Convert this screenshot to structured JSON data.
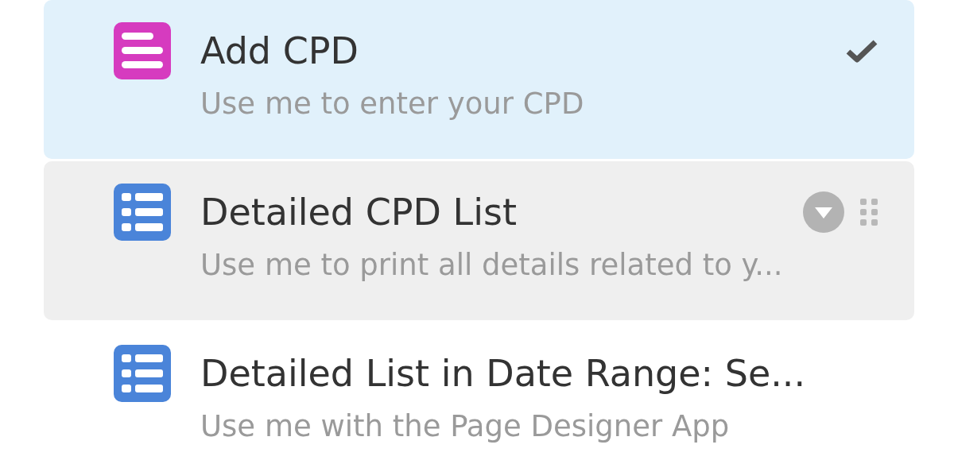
{
  "items": [
    {
      "kind": "form",
      "title": "Add CPD",
      "subtitle": "Use me to enter your CPD",
      "selected": true,
      "hovered": false
    },
    {
      "kind": "list",
      "title": "Detailed CPD List",
      "subtitle": "Use me to print all details related to y...",
      "selected": false,
      "hovered": true
    },
    {
      "kind": "list",
      "title": "Detailed List in Date Range: Se...",
      "subtitle": "Use me with the Page Designer App",
      "selected": false,
      "hovered": false
    }
  ]
}
